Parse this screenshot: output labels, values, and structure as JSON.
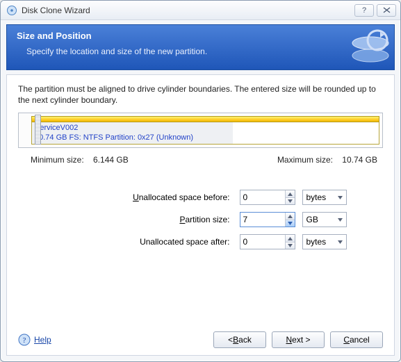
{
  "window": {
    "title": "Disk Clone Wizard"
  },
  "header": {
    "title": "Size and Position",
    "subtitle": "Specify the location and size of the new partition."
  },
  "instruction": "The partition must be aligned to drive cylinder boundaries. The entered size will be rounded up to the next cylinder boundary.",
  "partition": {
    "name": "ServiceV002",
    "info": "10.74 GB  FS: NTFS Partition: 0x27 (Unknown)"
  },
  "limits": {
    "min_label": "Minimum size:",
    "min_value": "6.144 GB",
    "max_label": "Maximum size:",
    "max_value": "10.74 GB"
  },
  "fields": {
    "before": {
      "label_pre": "U",
      "label_rest": "nallocated space before:",
      "value": "0",
      "unit": "bytes"
    },
    "size": {
      "label_pre": "P",
      "label_rest": "artition size:",
      "value": "7",
      "unit": "GB"
    },
    "after": {
      "label_pre": "",
      "label_rest": "Unallocated space after:",
      "value": "0",
      "unit": "bytes"
    }
  },
  "footer": {
    "help": "Help",
    "back": {
      "pre": "< ",
      "ul": "B",
      "rest": "ack"
    },
    "next": {
      "ul": "N",
      "rest": "ext >"
    },
    "cancel": {
      "ul": "C",
      "rest": "ancel"
    }
  }
}
